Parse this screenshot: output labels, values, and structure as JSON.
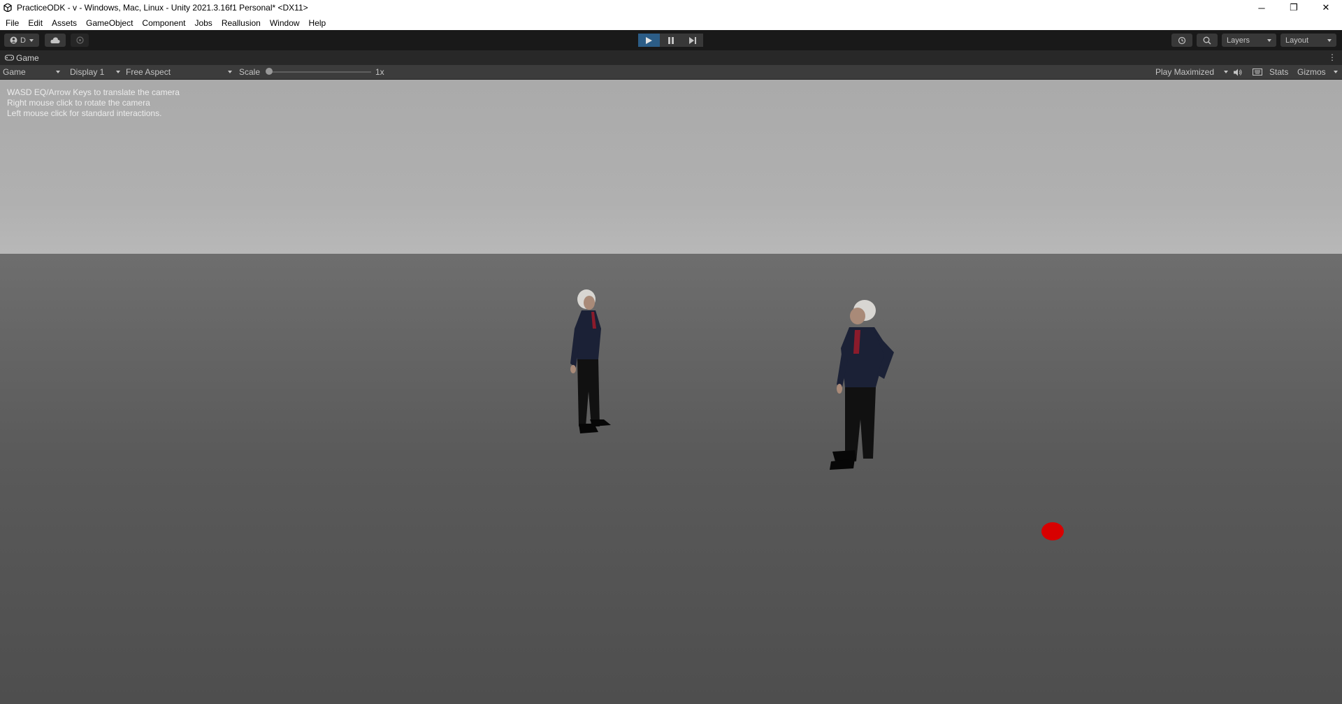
{
  "window": {
    "title": "PracticeODK - v - Windows, Mac, Linux - Unity 2021.3.16f1 Personal* <DX11>",
    "controls": {
      "minimize": "─",
      "restore": "❐",
      "close": "✕"
    }
  },
  "menu": [
    "File",
    "Edit",
    "Assets",
    "GameObject",
    "Component",
    "Jobs",
    "Reallusion",
    "Window",
    "Help"
  ],
  "toolbar": {
    "account_label": "D",
    "layers_label": "Layers",
    "layout_label": "Layout",
    "play_state": "playing"
  },
  "tab": {
    "label": "Game"
  },
  "game_toolbar": {
    "view_mode": "Game",
    "display": "Display 1",
    "aspect": "Free Aspect",
    "scale_label": "Scale",
    "scale_value": "1x",
    "play_mode": "Play Maximized",
    "stats_label": "Stats",
    "gizmos_label": "Gizmos"
  },
  "viewport": {
    "help_lines": [
      "WASD EQ/Arrow Keys to translate the camera",
      "Right mouse click to rotate the camera",
      "Left mouse click for standard interactions."
    ],
    "colors": {
      "sky": "#aaaaaa",
      "ground": "#5e5e5e",
      "marker": "#d80000",
      "suit": "#1b2136"
    }
  }
}
